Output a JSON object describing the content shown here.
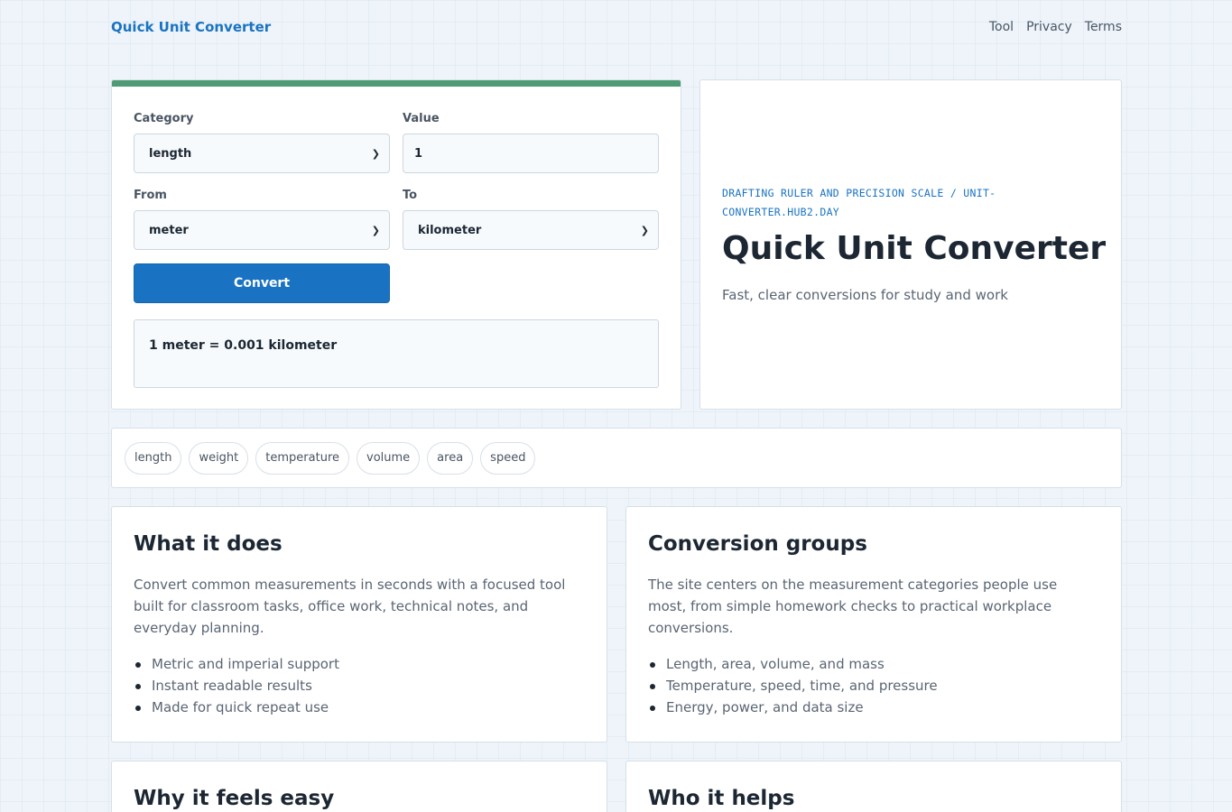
{
  "header": {
    "brand": "Quick Unit Converter",
    "nav": [
      "Tool",
      "Privacy",
      "Terms"
    ]
  },
  "form": {
    "category_label": "Category",
    "category_value": "length",
    "value_label": "Value",
    "value_value": "1",
    "from_label": "From",
    "from_value": "meter",
    "to_label": "To",
    "to_value": "kilometer",
    "convert_label": "Convert",
    "result": "1 meter = 0.001 kilometer"
  },
  "hero": {
    "kicker": "DRAFTING RULER AND PRECISION SCALE / UNIT-CONVERTER.HUB2.DAY",
    "title": "Quick Unit Converter",
    "subtitle": "Fast, clear conversions for study and work"
  },
  "chips": [
    "length",
    "weight",
    "temperature",
    "volume",
    "area",
    "speed"
  ],
  "cards": {
    "what": {
      "title": "What it does",
      "text": "Convert common measurements in seconds with a focused tool built for classroom tasks, office work, technical notes, and everyday planning.",
      "items": [
        "Metric and imperial support",
        "Instant readable results",
        "Made for quick repeat use"
      ]
    },
    "groups": {
      "title": "Conversion groups",
      "text": "The site centers on the measurement categories people use most, from simple homework checks to practical workplace conversions.",
      "items": [
        "Length, area, volume, and mass",
        "Temperature, speed, time, and pressure",
        "Energy, power, and data size"
      ]
    },
    "why": {
      "title": "Why it feels easy"
    },
    "who": {
      "title": "Who it helps"
    }
  },
  "colors": {
    "accent": "#1a73c2",
    "topbar": "#4e9b75",
    "background": "#eef4f9"
  }
}
